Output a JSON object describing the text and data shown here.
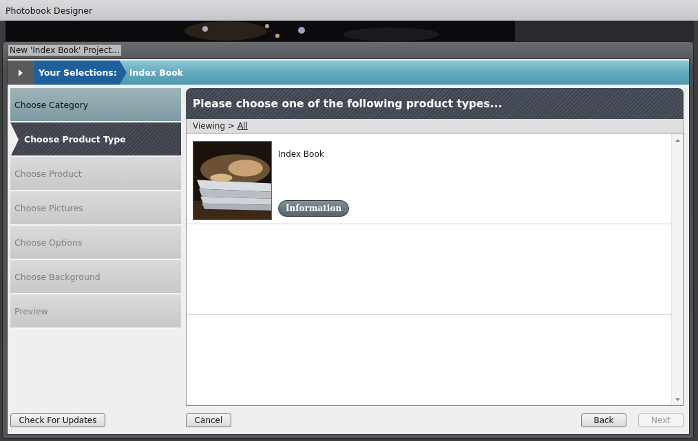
{
  "app_window": {
    "title": "Photobook Designer"
  },
  "dialog": {
    "title": "New 'Index Book' Project..."
  },
  "breadcrumb": {
    "label": "Your Selections:",
    "value": "Index Book"
  },
  "steps": [
    {
      "label": "Choose Category",
      "kind": "done"
    },
    {
      "label": "Choose Product Type",
      "kind": "current"
    },
    {
      "label": "Choose Product",
      "kind": "pending"
    },
    {
      "label": "Choose Pictures",
      "kind": "pending"
    },
    {
      "label": "Choose Options",
      "kind": "pending"
    },
    {
      "label": "Choose Background",
      "kind": "pending"
    },
    {
      "label": "Preview",
      "kind": "pending"
    }
  ],
  "panel": {
    "title": "Please choose one of the following product types...",
    "viewing_label": "Viewing >",
    "viewing_link": "All"
  },
  "products": [
    {
      "name": "Index Book",
      "button": "Information",
      "kind": "picture"
    }
  ],
  "footer": {
    "update_button": "Check For Updates",
    "cancel_button": "Cancel",
    "back_button": {
      "label": "Back",
      "disabled": false
    },
    "next_button": {
      "label": "Next",
      "disabled": true
    }
  }
}
